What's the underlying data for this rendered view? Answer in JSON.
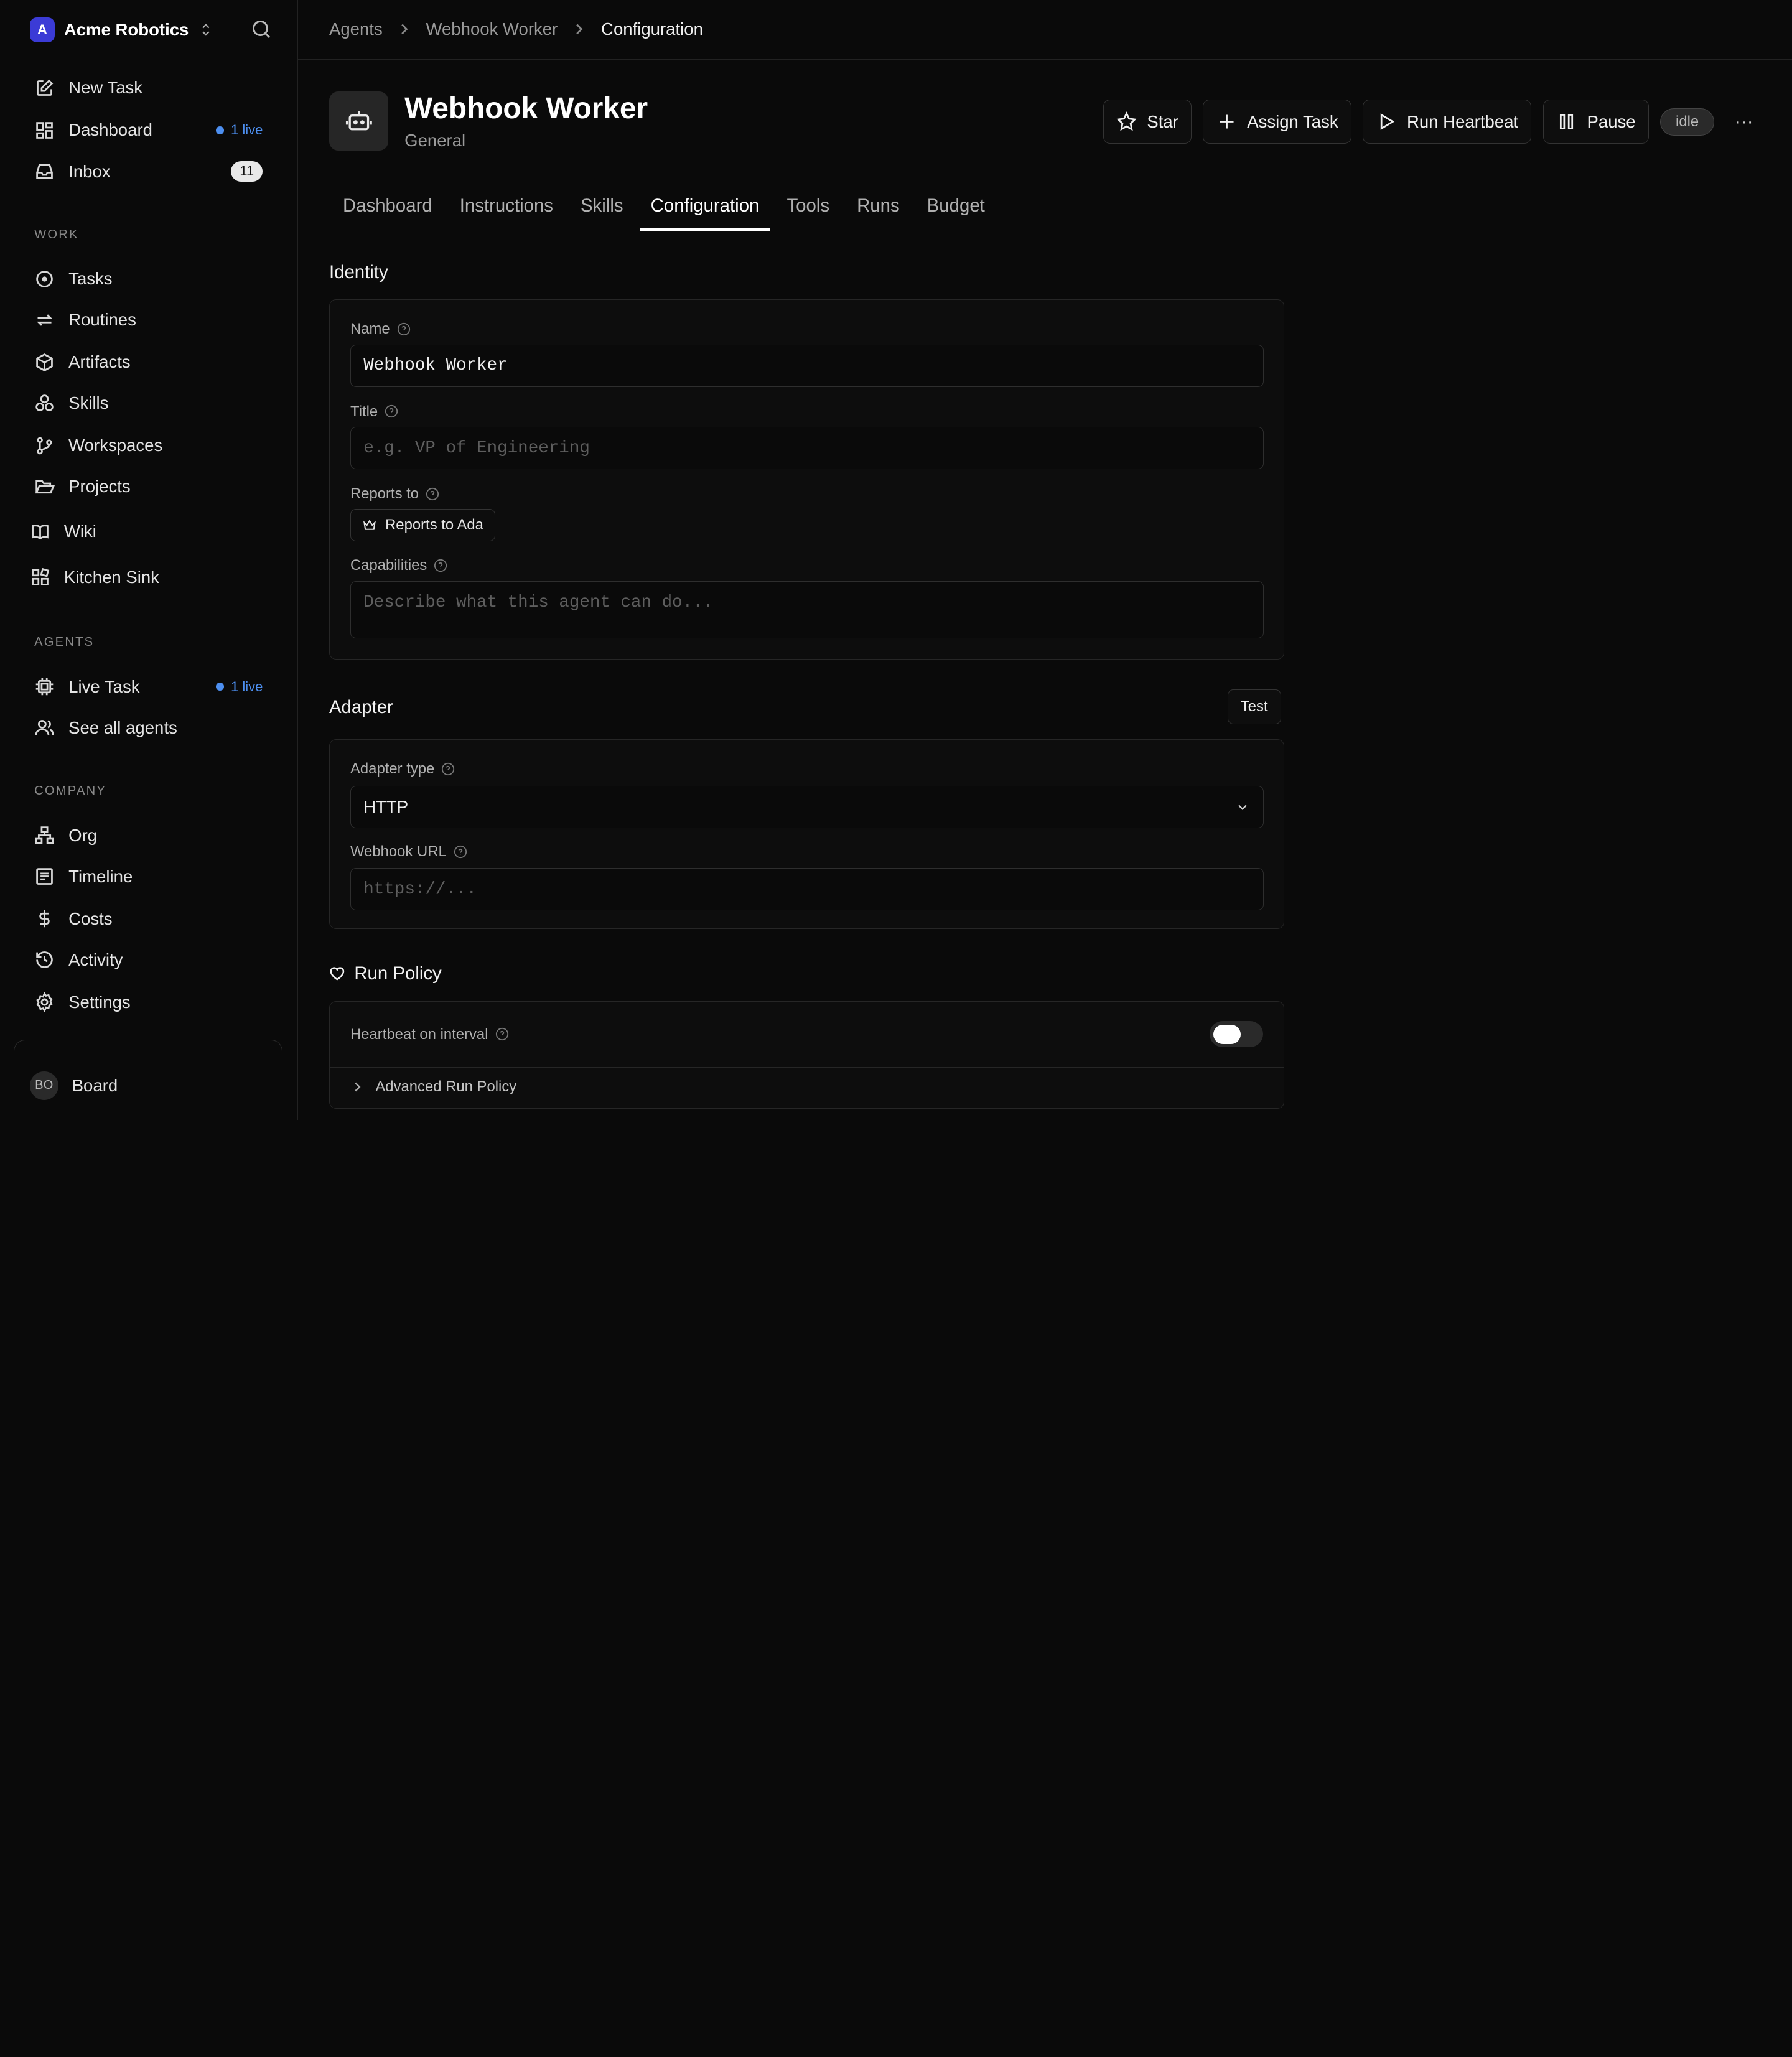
{
  "sidebar": {
    "company_initial": "A",
    "company_name": "Acme Robotics",
    "top_items": {
      "new_task": "New Task",
      "dashboard": "Dashboard",
      "dashboard_live": "1 live",
      "inbox": "Inbox",
      "inbox_count": "11"
    },
    "work_label": "WORK",
    "work_items": {
      "tasks": "Tasks",
      "routines": "Routines",
      "artifacts": "Artifacts",
      "skills": "Skills",
      "workspaces": "Workspaces",
      "projects": "Projects",
      "wiki": "Wiki",
      "kitchen_sink": "Kitchen Sink"
    },
    "agents_label": "AGENTS",
    "agents_items": {
      "live_task": "Live Task",
      "live_task_live": "1 live",
      "see_all": "See all agents"
    },
    "company_label": "COMPANY",
    "company_items": {
      "org": "Org",
      "timeline": "Timeline",
      "costs": "Costs",
      "activity": "Activity",
      "settings": "Settings"
    },
    "user_initials": "BO",
    "user_label": "Board"
  },
  "breadcrumb": {
    "agents": "Agents",
    "agent": "Webhook Worker",
    "current": "Configuration"
  },
  "header": {
    "title": "Webhook Worker",
    "subtitle": "General",
    "star_label": "Star",
    "assign_label": "Assign Task",
    "heartbeat_label": "Run Heartbeat",
    "pause_label": "Pause",
    "status": "idle",
    "more": "···"
  },
  "tabs": {
    "dashboard": "Dashboard",
    "instructions": "Instructions",
    "skills": "Skills",
    "configuration": "Configuration",
    "tools": "Tools",
    "runs": "Runs",
    "budget": "Budget"
  },
  "identity": {
    "section_title": "Identity",
    "name_label": "Name",
    "name_value": "Webhook Worker",
    "title_label": "Title",
    "title_placeholder": "e.g. VP of Engineering",
    "reports_label": "Reports to",
    "reports_value": "Reports to Ada",
    "capabilities_label": "Capabilities",
    "capabilities_placeholder": "Describe what this agent can do..."
  },
  "adapter": {
    "section_title": "Adapter",
    "test_label": "Test",
    "type_label": "Adapter type",
    "type_value": "HTTP",
    "url_label": "Webhook URL",
    "url_placeholder": "https://..."
  },
  "run_policy": {
    "section_title": "Run Policy",
    "heartbeat_label": "Heartbeat on interval",
    "heartbeat_enabled": false,
    "advanced_label": "Advanced Run Policy"
  },
  "colors": {
    "accent_blue": "#4d8ff0",
    "logo": "#3b3bd6"
  }
}
